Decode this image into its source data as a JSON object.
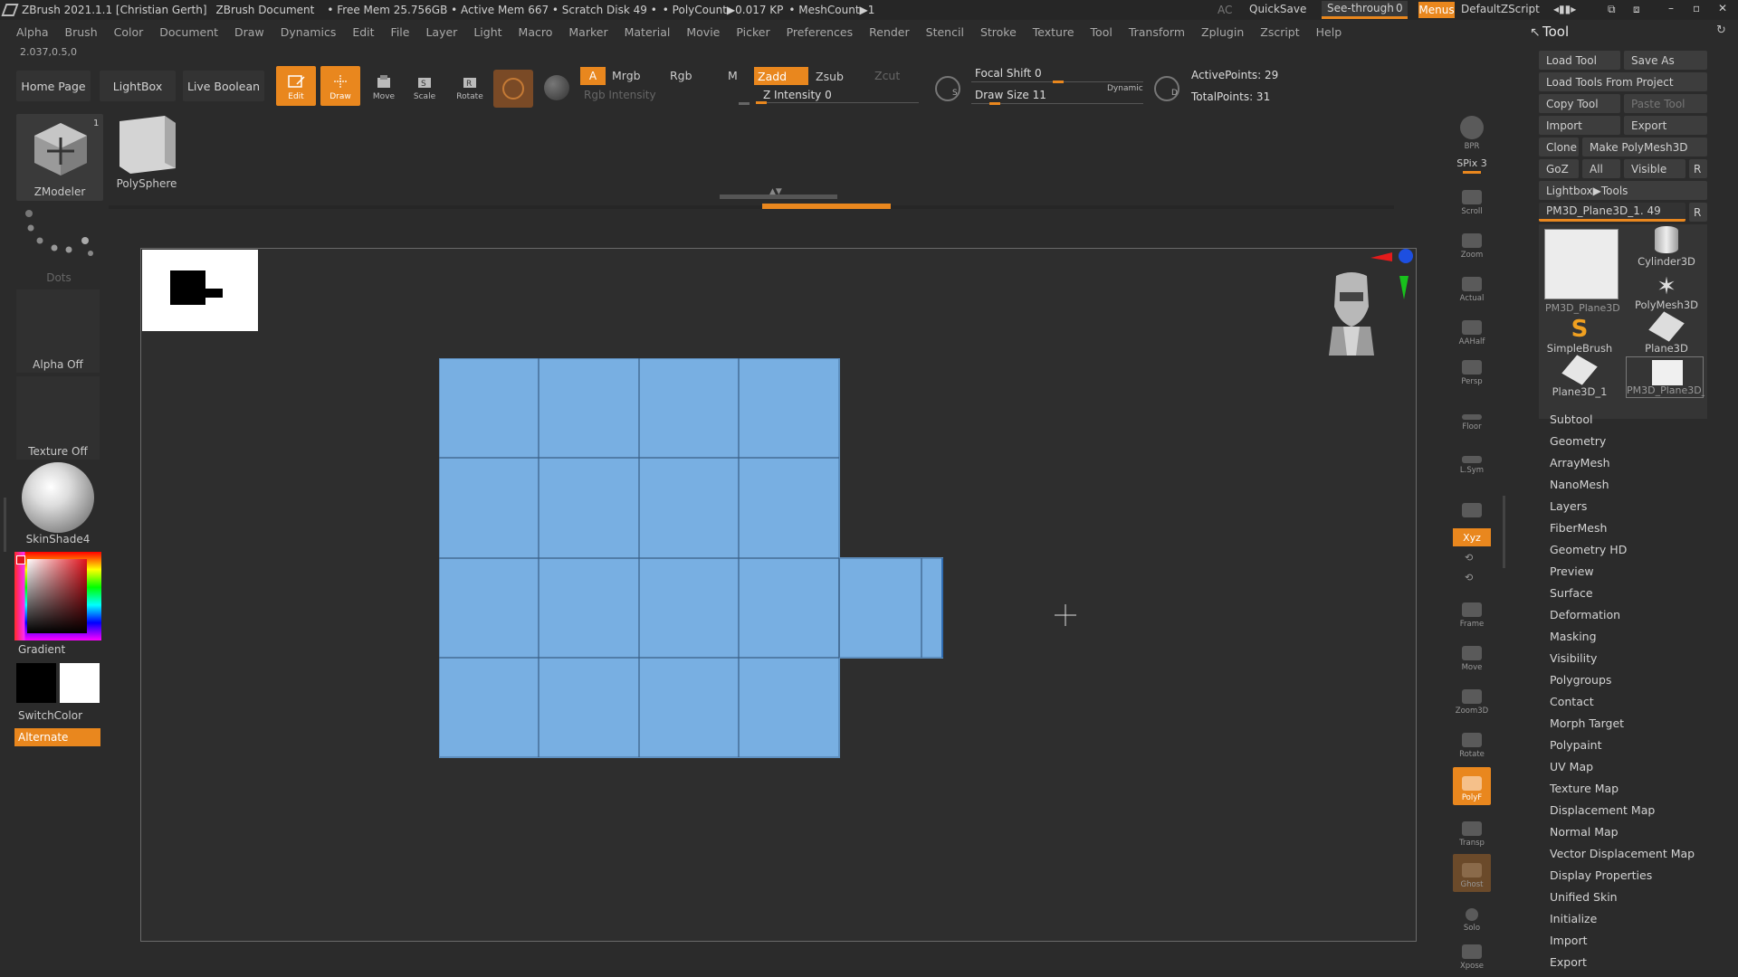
{
  "titlebar": {
    "app": "ZBrush 2021.1.1 [Christian Gerth]",
    "doc": "ZBrush Document",
    "stats": "• Free Mem 25.756GB • Active Mem 667 • Scratch Disk 49 •",
    "polycount": "• PolyCount▶0.017 KP",
    "meshcount": "• MeshCount▶1",
    "ac": "AC",
    "quicksave": "QuickSave",
    "seethrough": "See-through",
    "seethrough_val": "0",
    "menus": "Menus",
    "script": "DefaultZScript"
  },
  "menubar": [
    "Alpha",
    "Brush",
    "Color",
    "Document",
    "Draw",
    "Dynamics",
    "Edit",
    "File",
    "Layer",
    "Light",
    "Macro",
    "Marker",
    "Material",
    "Movie",
    "Picker",
    "Preferences",
    "Render",
    "Stencil",
    "Stroke",
    "Texture",
    "Tool",
    "Transform",
    "Zplugin",
    "Zscript",
    "Help"
  ],
  "coords": "2.037,0.5,0",
  "toolbar": {
    "home": "Home Page",
    "lightbox": "LightBox",
    "liveboolean": "Live Boolean",
    "edit": "Edit",
    "draw": "Draw",
    "move": "Move",
    "scale": "Scale",
    "rotate": "Rotate",
    "a": "A",
    "mrgb": "Mrgb",
    "rgb": "Rgb",
    "m": "M",
    "zadd": "Zadd",
    "zsub": "Zsub",
    "zcut": "Zcut",
    "rgb_intensity": "Rgb Intensity",
    "z_intensity": "Z Intensity 0",
    "focal_shift": "Focal Shift 0",
    "draw_size": "Draw Size 11",
    "dynamic": "Dynamic",
    "active_points": "ActivePoints: 29",
    "total_points": "TotalPoints: 31",
    "s_label": "S",
    "d_label": "D"
  },
  "leftpanel": {
    "zmodeler": "ZModeler",
    "zmodeler_count": "1",
    "polysphere": "PolySphere",
    "dots": "Dots",
    "alpha": "Alpha Off",
    "texture": "Texture Off",
    "material": "SkinShade4",
    "gradient": "Gradient",
    "switchcolor": "SwitchColor",
    "alternate": "Alternate"
  },
  "righttools": [
    "BPR",
    "SPix 3",
    "Scroll",
    "Zoom",
    "Actual",
    "AAHalf",
    "Persp",
    "Floor",
    "L.Sym",
    "",
    "Xyz",
    "",
    "",
    "Frame",
    "Move",
    "Zoom3D",
    "Rotate",
    "PolyF",
    "Transp",
    "Ghost",
    "Solo",
    "Xpose"
  ],
  "toolpanel": {
    "title": "Tool",
    "load_tool": "Load Tool",
    "save_as": "Save As",
    "load_from_project": "Load Tools From Project",
    "copy_tool": "Copy Tool",
    "paste_tool": "Paste Tool",
    "import": "Import",
    "export": "Export",
    "clone": "Clone",
    "make_polymesh": "Make PolyMesh3D",
    "goz": "GoZ",
    "all": "All",
    "visible": "Visible",
    "r": "R",
    "lightbox_tools": "Lightbox▶Tools",
    "current_tool": "PM3D_Plane3D_1. 49",
    "thumbs": [
      "PM3D_Plane3D_",
      "Cylinder3D",
      "PolyMesh3D",
      "SimpleBrush",
      "Plane3D",
      "Plane3D_1",
      "PM3D_Plane3D_"
    ],
    "sections": [
      "Subtool",
      "Geometry",
      "ArrayMesh",
      "NanoMesh",
      "Layers",
      "FiberMesh",
      "Geometry HD",
      "Preview",
      "Surface",
      "Deformation",
      "Masking",
      "Visibility",
      "Polygroups",
      "Contact",
      "Morph Target",
      "Polypaint",
      "UV Map",
      "Texture Map",
      "Displacement Map",
      "Normal Map",
      "Vector Displacement Map",
      "Display Properties",
      "Unified Skin",
      "Initialize",
      "Import",
      "Export"
    ]
  },
  "colors": {
    "accent": "#e9871e",
    "mesh": "#78afe2",
    "mesh_line": "#2f4f6f"
  }
}
